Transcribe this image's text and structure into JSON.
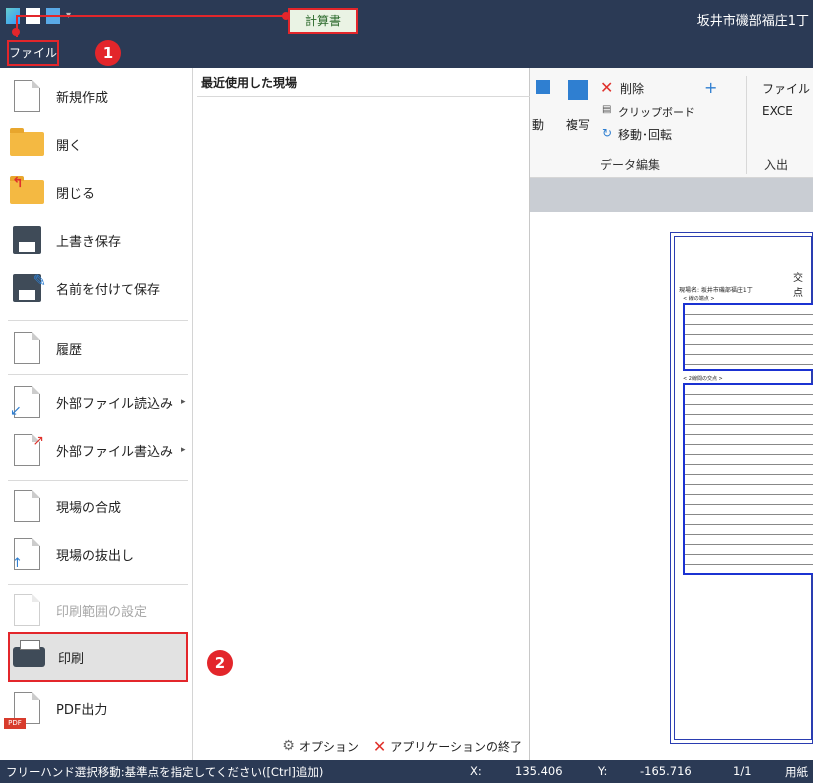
{
  "titlebar": {
    "context_tab": "計算書",
    "window_title": "坂井市磯部福庄1丁"
  },
  "file_tab": "ファイル",
  "menu": {
    "items": [
      {
        "label": "新規作成",
        "icon": "new-document-icon"
      },
      {
        "label": "開く",
        "icon": "folder-icon"
      },
      {
        "label": "閉じる",
        "icon": "close-folder-icon"
      },
      {
        "label": "上書き保存",
        "icon": "save-icon"
      },
      {
        "label": "名前を付けて保存",
        "icon": "save-as-icon"
      },
      {
        "label": "履歴",
        "icon": "history-icon"
      },
      {
        "label": "外部ファイル読込み",
        "icon": "import-icon"
      },
      {
        "label": "外部ファイル書込み",
        "icon": "export-icon"
      },
      {
        "label": "現場の合成",
        "icon": "merge-icon"
      },
      {
        "label": "現場の抜出し",
        "icon": "extract-icon"
      },
      {
        "label": "印刷範囲の設定",
        "icon": "print-range-icon"
      },
      {
        "label": "印刷",
        "icon": "printer-icon"
      },
      {
        "label": "PDF出力",
        "icon": "pdf-icon"
      }
    ],
    "submenu_arrow": "▸",
    "pdf_badge": "PDF"
  },
  "recent": {
    "title": "最近使用した現場"
  },
  "bottom": {
    "options": "オプション",
    "exit": "アプリケーションの終了"
  },
  "ribbon": {
    "delete": "削除",
    "clipboard": "クリップボード",
    "move_rotate": "移動･回転",
    "move": "動",
    "copy": "複写",
    "file": "ファイル",
    "excel": "EXCE",
    "group_data_edit": "データ編集",
    "group_io": "入出"
  },
  "document": {
    "title": "交 点",
    "site": "現場名: 坂井市磯部福庄1丁",
    "section1": "< 線の端点 >",
    "section2": "< 2線間の交点 >"
  },
  "callouts": [
    "1",
    "2"
  ],
  "statusbar": {
    "message": "フリーハンド選択移動:基準点を指定してください([Ctrl]追加)",
    "x_label": "X:",
    "x_value": "135.406",
    "y_label": "Y:",
    "y_value": "-165.716",
    "page": "1/1",
    "paper": "用紙"
  },
  "colors": {
    "titlebar": "#2b3a55",
    "highlight": "#e3262b",
    "selected_bg": "#e2e2e2"
  }
}
